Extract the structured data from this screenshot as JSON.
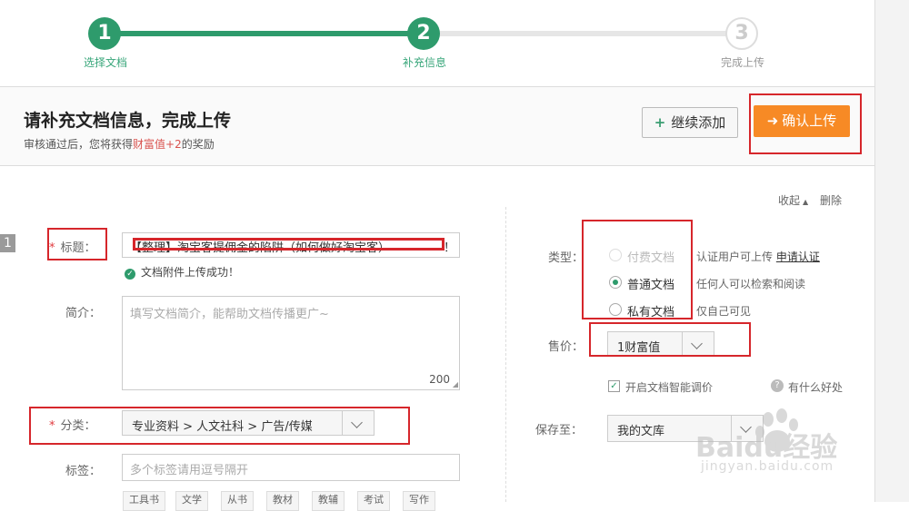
{
  "steps": [
    {
      "num": "1",
      "label": "选择文档"
    },
    {
      "num": "2",
      "label": "补充信息"
    },
    {
      "num": "3",
      "label": "完成上传"
    }
  ],
  "header": {
    "title": "请补充文档信息，完成上传",
    "subtitle_pre": "审核通过后，您将获得",
    "subtitle_highlight": "财富值+2",
    "subtitle_post": "的奖励"
  },
  "toolbar": {
    "add_label": "继续添加",
    "confirm_label": "确认上传"
  },
  "panel": {
    "collapse_label": "收起",
    "delete_label": "删除",
    "row_number": "1"
  },
  "form": {
    "title_label": "标题：",
    "title_value": "【整理】淘宝客提佣金的陷阱（如何做好淘宝客）",
    "title_end_mark": "！",
    "upload_success": "文档附件上传成功！",
    "intro_label": "简介：",
    "intro_placeholder": "填写文档简介，能帮助文档传播更广~",
    "intro_counter": "200",
    "category_label": "分类：",
    "category_value": "专业资料 > 人文社科 > 广告/传媒",
    "tags_label": "标签：",
    "tags_placeholder": "多个标签请用逗号隔开",
    "tag_chips": [
      "工具书",
      "文学",
      "从书",
      "教材",
      "教辅",
      "考试",
      "写作"
    ]
  },
  "settings": {
    "type_label": "类型：",
    "type_options": [
      {
        "label": "付费文档",
        "desc": "认证用户可上传",
        "link": "申请认证"
      },
      {
        "label": "普通文档",
        "desc": "任何人可以检索和阅读"
      },
      {
        "label": "私有文档",
        "desc": "仅自己可见"
      }
    ],
    "price_label": "售价：",
    "price_value": "1财富值",
    "smart_price_label": "开启文档智能调价",
    "benefit_label": "有什么好处",
    "save_label": "保存至：",
    "save_value": "我的文库"
  },
  "watermark": {
    "brand": "Baidu经验",
    "url": "jingyan.baidu.com"
  },
  "colors": {
    "accent_green": "#2e9b6c",
    "confirm_orange": "#f78a25",
    "highlight_red": "#d6262b"
  }
}
